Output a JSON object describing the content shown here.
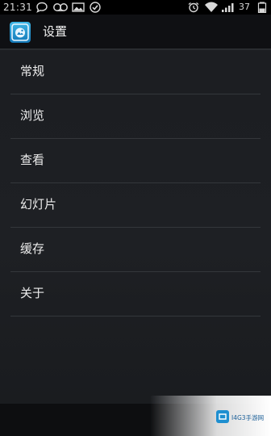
{
  "status_bar": {
    "time": "21:31",
    "battery_percent": "37",
    "icons": [
      "chat-icon",
      "voicemail-icon",
      "image-icon",
      "check-icon",
      "alarm-icon",
      "wifi-icon",
      "signal-icon",
      "battery-icon"
    ]
  },
  "action_bar": {
    "app_icon": "gallery-app-icon",
    "title": "设置"
  },
  "menu": {
    "items": [
      {
        "label": "常规"
      },
      {
        "label": "浏览"
      },
      {
        "label": "查看"
      },
      {
        "label": "幻灯片"
      },
      {
        "label": "缓存"
      },
      {
        "label": "关于"
      }
    ]
  },
  "watermark": {
    "text": "I4G3手游网"
  },
  "colors": {
    "accent": "#1e8fd0",
    "background": "#1d1f23",
    "text": "#ececec",
    "divider": "#34373b"
  }
}
